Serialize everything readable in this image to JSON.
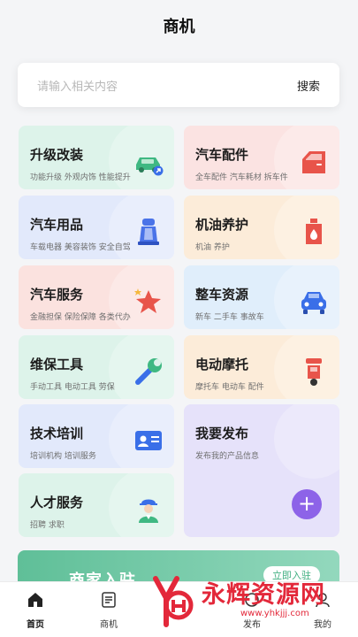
{
  "header": {
    "title": "商机"
  },
  "search": {
    "placeholder": "请输入相关内容",
    "button": "搜索"
  },
  "cards": [
    {
      "title": "升级改装",
      "sub": "功能升级  外观内饰  性能提升",
      "icon": "car-upgrade-icon"
    },
    {
      "title": "汽车配件",
      "sub": "全车配件  汽车耗材  拆车件",
      "icon": "car-door-icon"
    },
    {
      "title": "汽车用品",
      "sub": "车载电器  美容装饰  安全自驾",
      "icon": "car-seat-icon"
    },
    {
      "title": "机油养护",
      "sub": "机油  养护",
      "icon": "oil-can-icon"
    },
    {
      "title": "汽车服务",
      "sub": "金融担保  保险保障  各类代办",
      "icon": "star-badge-icon"
    },
    {
      "title": "整车资源",
      "sub": "新车    二手车    事故车",
      "icon": "car-front-icon"
    },
    {
      "title": "维保工具",
      "sub": "手动工具  电动工具  劳保",
      "icon": "wrench-icon"
    },
    {
      "title": "电动摩托",
      "sub": "摩托车  电动车  配件",
      "icon": "scooter-icon"
    },
    {
      "title": "技术培训",
      "sub": "培训机构  培训服务",
      "icon": "id-card-icon"
    },
    {
      "title": "我要发布",
      "sub": "发布我的产品信息",
      "icon": "plus-icon"
    },
    {
      "title": "人才服务",
      "sub": "招聘  求职",
      "icon": "worker-icon"
    }
  ],
  "banner": {
    "title": "商家入驻",
    "button": "立即入驻"
  },
  "tabs": [
    {
      "label": "首页",
      "icon": "home-icon",
      "active": true
    },
    {
      "label": "商机",
      "icon": "list-icon",
      "active": false
    },
    {
      "label": "发布",
      "icon": "publish-icon",
      "active": false
    },
    {
      "label": "我的",
      "icon": "user-icon",
      "active": false
    }
  ],
  "watermark": {
    "text": "永辉资源网",
    "url": "www.yhkjjj.com"
  },
  "colors": {
    "accent": "#8d63e8",
    "banner": "#5fbf98",
    "watermark": "#e3283a"
  }
}
